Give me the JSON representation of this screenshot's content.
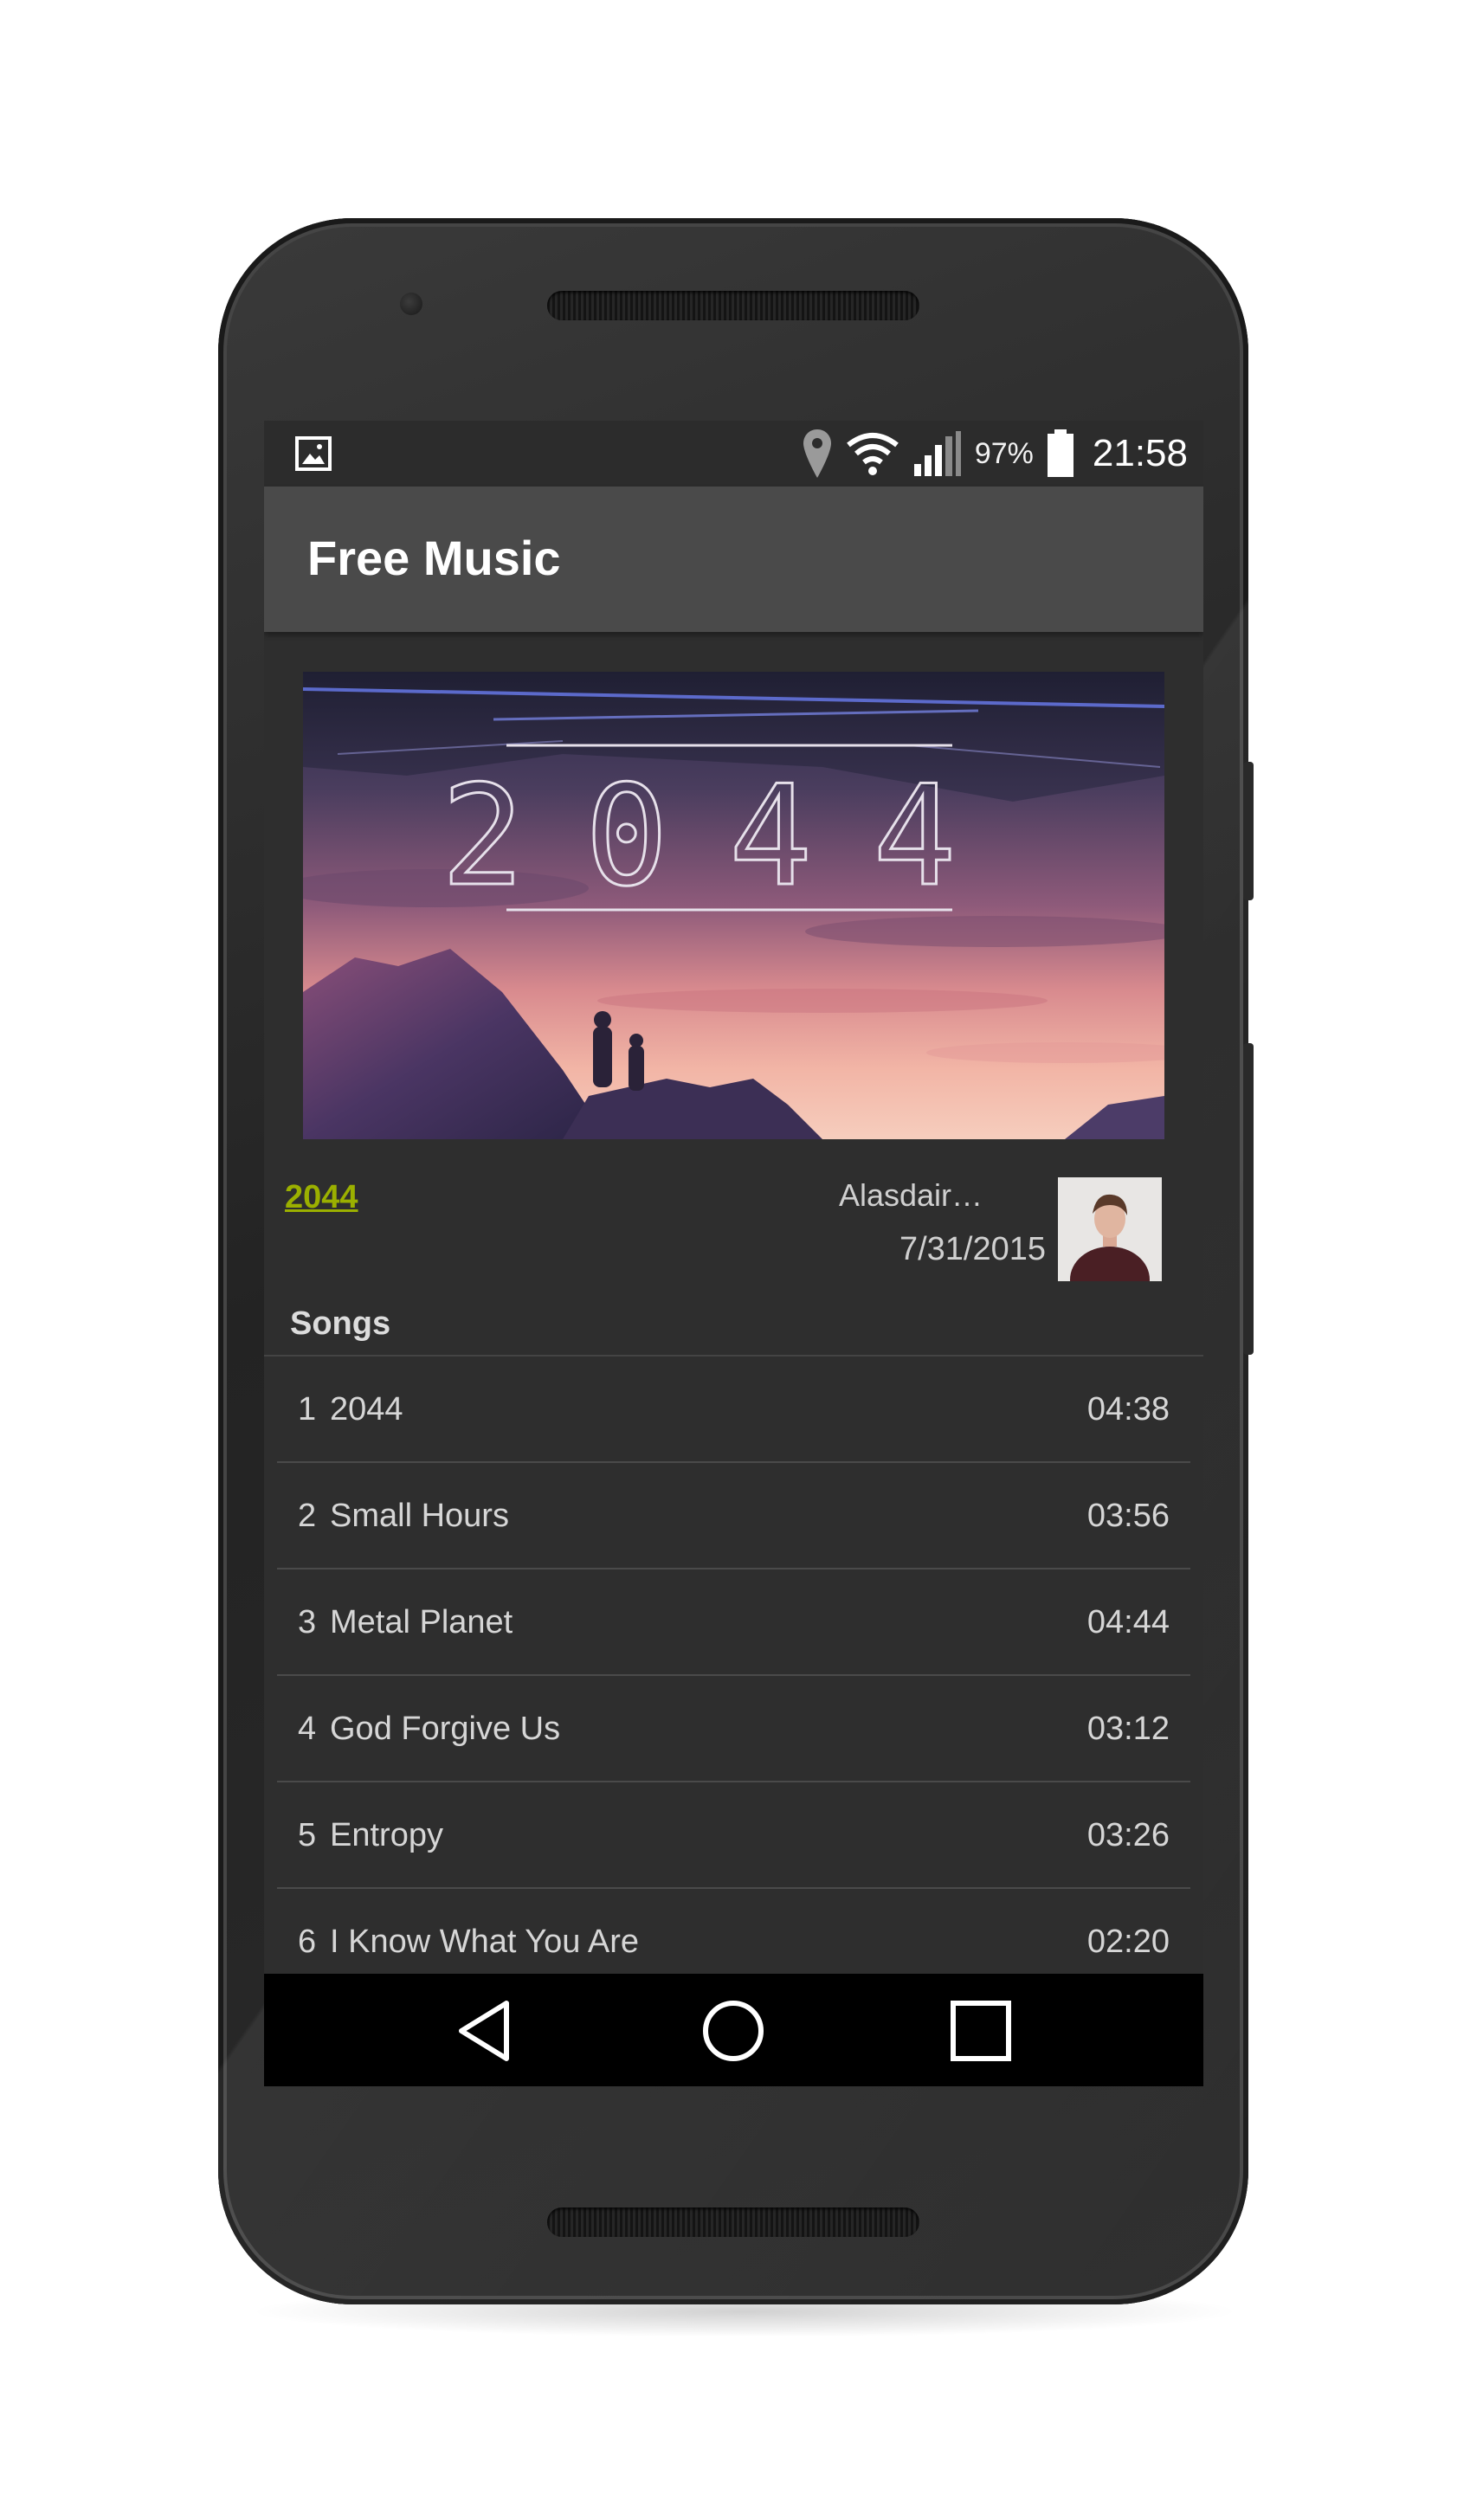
{
  "statusbar": {
    "battery_percent": "97%",
    "time": "21:58",
    "icons": [
      "image-notification-icon",
      "location-icon",
      "wifi-icon",
      "signal-icon",
      "battery-icon"
    ]
  },
  "appbar": {
    "title": "Free Music"
  },
  "album": {
    "title": "2044",
    "cover_text": "2044",
    "artist": "Alasdair…",
    "release_date": "7/31/2015"
  },
  "songs_section": {
    "header": "Songs",
    "songs": [
      {
        "number": "1",
        "title": "2044",
        "duration": "04:38"
      },
      {
        "number": "2",
        "title": "Small Hours",
        "duration": "03:56"
      },
      {
        "number": "3",
        "title": "Metal Planet",
        "duration": "04:44"
      },
      {
        "number": "4",
        "title": "God Forgive Us",
        "duration": "03:12"
      },
      {
        "number": "5",
        "title": "Entropy",
        "duration": "03:26"
      },
      {
        "number": "6",
        "title": "I Know What You Are",
        "duration": "02:20"
      }
    ]
  },
  "navbar": {
    "icons": [
      "back-icon",
      "home-icon",
      "recents-icon"
    ]
  },
  "colors": {
    "accent_link": "#9bb000",
    "appbar": "#4a4a4a",
    "background": "#2e2e2e",
    "navbar": "#000000"
  }
}
